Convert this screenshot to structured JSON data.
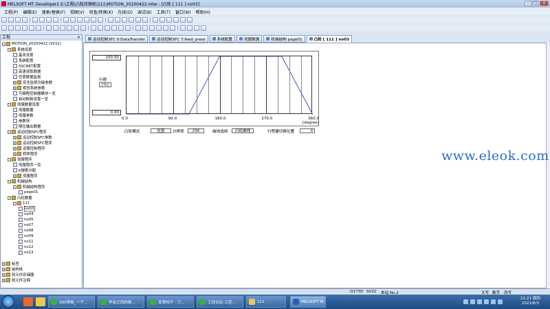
{
  "window": {
    "title": "MELSOFT MT Developer2 E:\\工程\\凸轮压铆机\\111\\MOTION_20200422.mtw - [凸轮 [ 111 ] no03]"
  },
  "menu": [
    "工程(P)",
    "编辑(E)",
    "搜索/替换(F)",
    "视图(V)",
    "检查/转换(K)",
    "在线(O)",
    "调试(B)",
    "工具(T)",
    "窗口(W)",
    "帮助(H)"
  ],
  "left_panel": {
    "title": "工程",
    "close": "×"
  },
  "tree": [
    {
      "label": "MOTION_20200422 (SV22)",
      "level": 0,
      "exp": "-",
      "type": "folder"
    },
    {
      "label": "系统设置",
      "level": 1,
      "exp": "-",
      "type": "folder"
    },
    {
      "label": "基本设置",
      "level": 2,
      "exp": "",
      "type": "doc"
    },
    {
      "label": "系统配置",
      "level": 2,
      "exp": "",
      "type": "doc"
    },
    {
      "label": "SSCNET配置",
      "level": 2,
      "exp": "",
      "type": "doc"
    },
    {
      "label": "高速读取数据",
      "level": 2,
      "exp": "",
      "type": "doc"
    },
    {
      "label": "任意数据监视",
      "level": 2,
      "exp": "",
      "type": "doc"
    },
    {
      "label": "安全监视功能参数",
      "level": 2,
      "exp": "+",
      "type": "folder"
    },
    {
      "label": "视觉系统参数",
      "level": 2,
      "exp": "+",
      "type": "folder"
    },
    {
      "label": "可编程控制器模块一览",
      "level": 2,
      "exp": "",
      "type": "doc"
    },
    {
      "label": "自动刷新设置一览",
      "level": 2,
      "exp": "",
      "type": "doc"
    },
    {
      "label": "伺服数据设置",
      "level": 1,
      "exp": "-",
      "type": "folder"
    },
    {
      "label": "伺服数据",
      "level": 2,
      "exp": "",
      "type": "doc"
    },
    {
      "label": "伺服参数",
      "level": 2,
      "exp": "",
      "type": "doc"
    },
    {
      "label": "参数块",
      "level": 2,
      "exp": "",
      "type": "doc"
    },
    {
      "label": "限位输出数据",
      "level": 2,
      "exp": "",
      "type": "doc"
    },
    {
      "label": "运动控制SFC程序",
      "level": 1,
      "exp": "-",
      "type": "folder"
    },
    {
      "label": "运动控制SFC参数",
      "level": 2,
      "exp": "+",
      "type": "folder"
    },
    {
      "label": "运动控制SFC程序",
      "level": 2,
      "exp": "+",
      "type": "folder"
    },
    {
      "label": "运算控制程序",
      "level": 2,
      "exp": "+",
      "type": "folder"
    },
    {
      "label": "转移程序",
      "level": 2,
      "exp": "+",
      "type": "folder"
    },
    {
      "label": "伺服程序",
      "level": 1,
      "exp": "-",
      "type": "folder"
    },
    {
      "label": "伺服程序一览",
      "level": 2,
      "exp": "",
      "type": "doc"
    },
    {
      "label": "K搜索分配",
      "level": 2,
      "exp": "",
      "type": "doc"
    },
    {
      "label": "伺服程序",
      "level": 2,
      "exp": "+",
      "type": "folder"
    },
    {
      "label": "机械结构",
      "level": 1,
      "exp": "-",
      "type": "folder"
    },
    {
      "label": "机械结构程序",
      "level": 2,
      "exp": "-",
      "type": "folder"
    },
    {
      "label": "page01",
      "level": 3,
      "exp": "",
      "type": "doc"
    },
    {
      "label": "凸轮数据",
      "level": 1,
      "exp": "-",
      "type": "folder"
    },
    {
      "label": "111",
      "level": 2,
      "exp": "-",
      "type": "folder"
    },
    {
      "label": "no03",
      "level": 3,
      "exp": "",
      "type": "doc",
      "selected": true
    },
    {
      "label": "no04",
      "level": 3,
      "exp": "",
      "type": "doc"
    },
    {
      "label": "no05",
      "level": 3,
      "exp": "",
      "type": "doc"
    },
    {
      "label": "no07",
      "level": 3,
      "exp": "",
      "type": "doc"
    },
    {
      "label": "no08",
      "level": 3,
      "exp": "",
      "type": "doc"
    },
    {
      "label": "no09",
      "level": 3,
      "exp": "",
      "type": "doc"
    },
    {
      "label": "no11",
      "level": 3,
      "exp": "",
      "type": "doc"
    },
    {
      "label": "no12",
      "level": 3,
      "exp": "",
      "type": "doc"
    },
    {
      "label": "no13",
      "level": 3,
      "exp": "",
      "type": "doc"
    },
    {
      "label": "标签",
      "level": 0,
      "exp": "+",
      "type": "folder",
      "gap": true
    },
    {
      "label": "结构体",
      "level": 0,
      "exp": "+",
      "type": "folder"
    },
    {
      "label": "软元件存储器",
      "level": 0,
      "exp": "+",
      "type": "folder"
    },
    {
      "label": "软元件注释",
      "level": 0,
      "exp": "+",
      "type": "folder"
    }
  ],
  "tabs": [
    {
      "label": "运动控制SFC 0:DataTransfer",
      "active": false
    },
    {
      "label": "运动控制SFC 7:feed_press",
      "active": false
    },
    {
      "label": "系统配置",
      "active": false
    },
    {
      "label": "伺服数据",
      "active": false
    },
    {
      "label": "机械结构 page01",
      "active": false
    },
    {
      "label": "凸轮 [ 111 ] no03",
      "active": true
    }
  ],
  "cam_editor": {
    "stroke_label": "行程",
    "stroke_unit": "[%]",
    "y_top": "100.00",
    "y_bottom": "0.00",
    "x_ticks": [
      "0.0",
      "90.0",
      "180.0",
      "270.0",
      "360.0"
    ],
    "x_unit": "[degree]",
    "cam_mode_label": "凸轮模式",
    "cam_mode_value": "往复",
    "resolution_label": "分辨率",
    "resolution_value": "256",
    "curve_select_label": "曲线选用",
    "curve_select_value": "凸轮曲线",
    "stroke_switch_label": "行程量切换位置",
    "stroke_switch_value": "0"
  },
  "chart_data": {
    "type": "line",
    "title": "",
    "xlabel": "[degree]",
    "ylabel": "行程 [%]",
    "xlim": [
      0,
      360
    ],
    "ylim": [
      0,
      100
    ],
    "series": [
      {
        "x": [
          0,
          120,
          180,
          300,
          360
        ],
        "y": [
          0,
          0,
          100,
          100,
          0
        ]
      }
    ]
  },
  "watermark": "www.eleok.com",
  "status": {
    "cpu": "Q173D",
    "os": "SV22",
    "station": "本站 No.2",
    "caps": "大写",
    "num": "数字",
    "ovr": "改写"
  },
  "taskbar": {
    "tasks": [
      "360导航_一个...",
      "学会之风的新...",
      "发表帖子 - 三...",
      "工控论坛-工控...",
      "111",
      "MELSOFT M..."
    ],
    "time": "21:21 周四",
    "date": "2021/6/3"
  },
  "colors": {
    "cam_curve": "#3b56c4",
    "watermark": "#2a6fc9"
  }
}
